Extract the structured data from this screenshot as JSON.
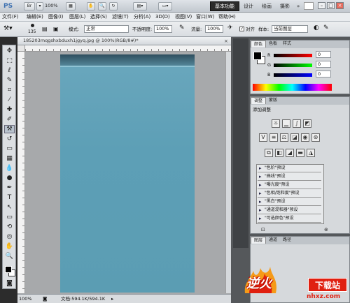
{
  "app": {
    "logo": "PS",
    "zoom_select": "100%",
    "workspaces": [
      "基本功能",
      "设计",
      "绘画",
      "摄影"
    ],
    "window_controls": [
      "–",
      "□",
      "×"
    ]
  },
  "menu": [
    "文件(F)",
    "编辑(E)",
    "图像(I)",
    "图层(L)",
    "选择(S)",
    "滤镜(T)",
    "分析(A)",
    "3D(D)",
    "视图(V)",
    "窗口(W)",
    "帮助(H)"
  ],
  "options": {
    "brush_size": "135",
    "mode_label": "模式:",
    "mode_value": "正常",
    "opacity_label": "不透明度:",
    "opacity_value": "100%",
    "flow_label": "流量:",
    "flow_value": "100%",
    "align_label": "对齐",
    "sample_label": "样本:",
    "sample_value": "当前图层"
  },
  "document": {
    "tab_title": "185203mqgshxbduxh1jgyq.jpg @ 100%(RGB/8#)*",
    "zoom": "100%",
    "doc_info": "文档:594.1K/594.1K"
  },
  "panels": {
    "color_tabs": [
      "颜色",
      "色板",
      "样式"
    ],
    "channels": [
      "R",
      "G",
      "B"
    ],
    "channel_values": [
      "0",
      "0",
      "0"
    ],
    "adjust_tabs": [
      "调整",
      "蒙版"
    ],
    "adjust_title": "添加调整",
    "presets": [
      "\"色阶\"预设",
      "\"曲线\"预设",
      "\"曝光度\"预设",
      "\"色相/饱和度\"预设",
      "\"黑白\"预设",
      "\"通道混和器\"预设",
      "\"可选颜色\"预设"
    ],
    "layer_tabs": [
      "图层",
      "通道",
      "路径"
    ]
  },
  "watermark": {
    "brand": "下载站",
    "site": "nhxz.com",
    "logo_text": "逆火"
  },
  "colors": {
    "canvas": "#5b9db3",
    "brand_red": "#e02010",
    "brand_orange": "#f59a18"
  }
}
